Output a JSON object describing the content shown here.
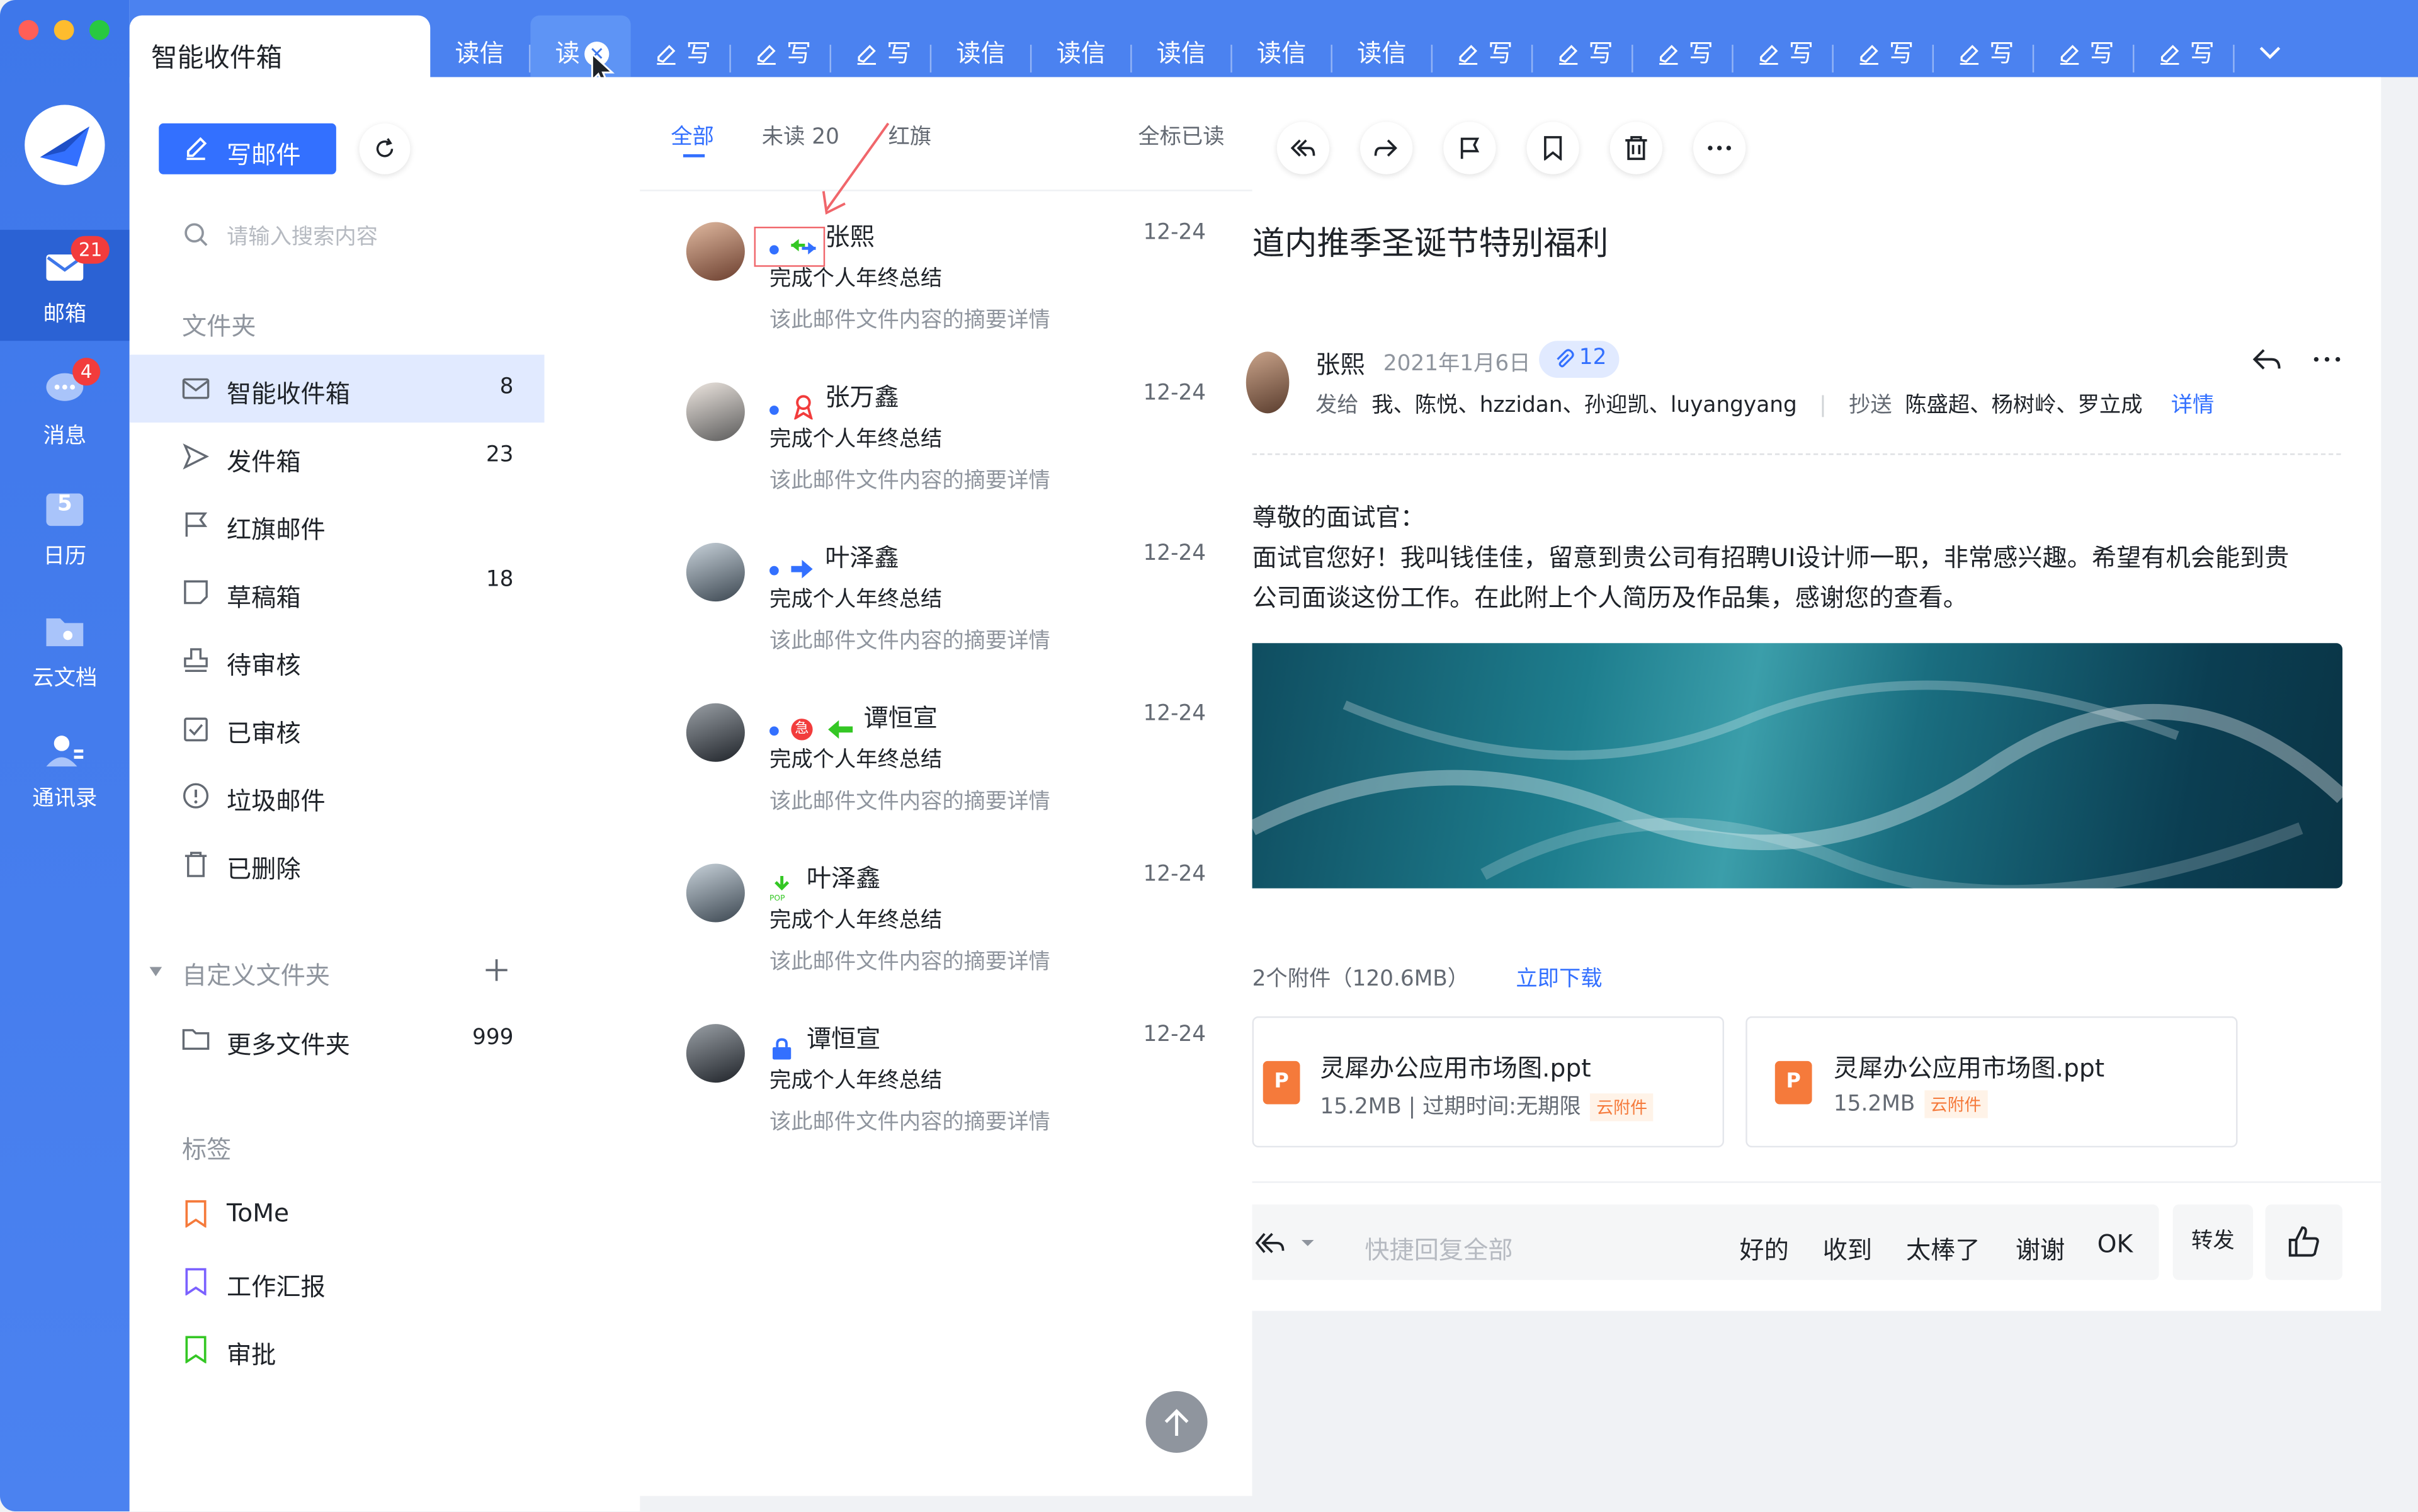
{
  "rail": {
    "items": [
      {
        "label": "邮箱",
        "badge": "21"
      },
      {
        "label": "消息",
        "badge": "4"
      },
      {
        "label": "日历",
        "day": "5"
      },
      {
        "label": "云文档"
      },
      {
        "label": "通讯录"
      }
    ]
  },
  "tabs": {
    "inbox": "智能收件箱",
    "items": [
      "读信",
      "读",
      "写",
      "写",
      "写",
      "读信",
      "读信",
      "读信",
      "读信",
      "读信",
      "写",
      "写",
      "写",
      "写",
      "写",
      "写",
      "写",
      "写"
    ]
  },
  "folders": {
    "compose": "写邮件",
    "search_placeholder": "请输入搜索内容",
    "section": "文件夹",
    "items": [
      {
        "label": "智能收件箱",
        "count": "8"
      },
      {
        "label": "发件箱",
        "count": "23"
      },
      {
        "label": "红旗邮件",
        "count": ""
      },
      {
        "label": "草稿箱",
        "count": "18"
      },
      {
        "label": "待审核",
        "count": ""
      },
      {
        "label": "已审核",
        "count": ""
      },
      {
        "label": "垃圾邮件",
        "count": ""
      },
      {
        "label": "已删除",
        "count": ""
      }
    ],
    "custom_section": "自定义文件夹",
    "more": {
      "label": "更多文件夹",
      "count": "999"
    },
    "tags_section": "标签",
    "tags": [
      {
        "label": "ToMe",
        "color": "#F57A3B"
      },
      {
        "label": "工作汇报",
        "color": "#7B61FF"
      },
      {
        "label": "审批",
        "color": "#34C724"
      }
    ]
  },
  "list": {
    "tab_all": "全部",
    "tab_unread": "未读 20",
    "tab_flag": "红旗",
    "mark_all": "全标已读",
    "mails": [
      {
        "sender": "张熙",
        "date": "12-24",
        "subject": "完成个人年终总结",
        "summary": "该此邮件文件内容的摘要详情"
      },
      {
        "sender": "张万鑫",
        "date": "12-24",
        "subject": "完成个人年终总结",
        "summary": "该此邮件文件内容的摘要详情"
      },
      {
        "sender": "叶泽鑫",
        "date": "12-24",
        "subject": "完成个人年终总结",
        "summary": "该此邮件文件内容的摘要详情"
      },
      {
        "sender": "谭恒宣",
        "date": "12-24",
        "subject": "完成个人年终总结",
        "summary": "该此邮件文件内容的摘要详情",
        "urgent": "急"
      },
      {
        "sender": "叶泽鑫",
        "date": "12-24",
        "subject": "完成个人年终总结",
        "summary": "该此邮件文件内容的摘要详情",
        "pop": "POP"
      },
      {
        "sender": "谭恒宣",
        "date": "12-24",
        "subject": "完成个人年终总结",
        "summary": "该此邮件文件内容的摘要详情"
      }
    ]
  },
  "reader": {
    "title": "道内推季圣诞节特别福利",
    "sender": "张熙",
    "date": "2021年1月6日",
    "attach_count": "12",
    "to_label": "发给",
    "to": "我、陈悦、hzzidan、孙迎凯、luyangyang",
    "cc_label": "抄送",
    "cc": "陈盛超、杨树岭、罗立成",
    "detail": "详情",
    "greeting": "尊敬的面试官：",
    "para1": "面试官您好！我叫钱佳佳，留意到贵公司有招聘UI设计师一职，非常感兴趣。希望有机会能到贵",
    "para2": "公司面谈这份工作。在此附上个人简历及作品集，感谢您的查看。",
    "attachments_summary": "2个附件（120.6MB）",
    "download": "立即下载",
    "files": [
      {
        "name": "灵犀办公应用市场图.ppt",
        "meta": "15.2MB | 过期时间:无期限",
        "tag": "云附件"
      },
      {
        "name": "灵犀办公应用市场图.ppt",
        "meta": "15.2MB",
        "tag": "云附件"
      }
    ],
    "reply_placeholder": "快捷回复全部",
    "quick": [
      "好的",
      "收到",
      "太棒了",
      "谢谢",
      "OK"
    ],
    "forward": "转发"
  }
}
